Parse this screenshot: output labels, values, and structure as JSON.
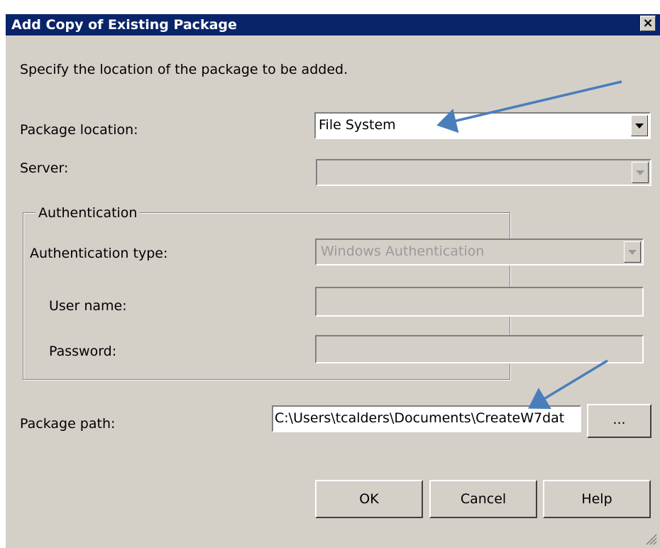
{
  "dialog": {
    "title": "Add Copy of Existing Package",
    "close_glyph": "×",
    "instruction": "Specify the location of the package to be added."
  },
  "fields": {
    "package_location_label": "Package location:",
    "package_location_value": "File System",
    "server_label": "Server:",
    "server_value": "",
    "authentication_group": "Authentication",
    "auth_type_label": "Authentication type:",
    "auth_type_value": "Windows Authentication",
    "user_name_label": "User name:",
    "user_name_value": "",
    "password_label": "Password:",
    "password_value": "",
    "package_path_label": "Package path:",
    "package_path_value": "C:\\Users\\tcalders\\Documents\\CreateW7dat",
    "browse_label": "..."
  },
  "buttons": {
    "ok": "OK",
    "cancel": "Cancel",
    "help": "Help"
  },
  "colors": {
    "title_bar": "#0a246a",
    "dialog_bg": "#d4d0c8",
    "annotation_arrow": "#4a7ebb"
  },
  "icons": {
    "close": "close-icon",
    "dropdown": "chevron-down-icon",
    "resize": "resize-grip-icon"
  }
}
